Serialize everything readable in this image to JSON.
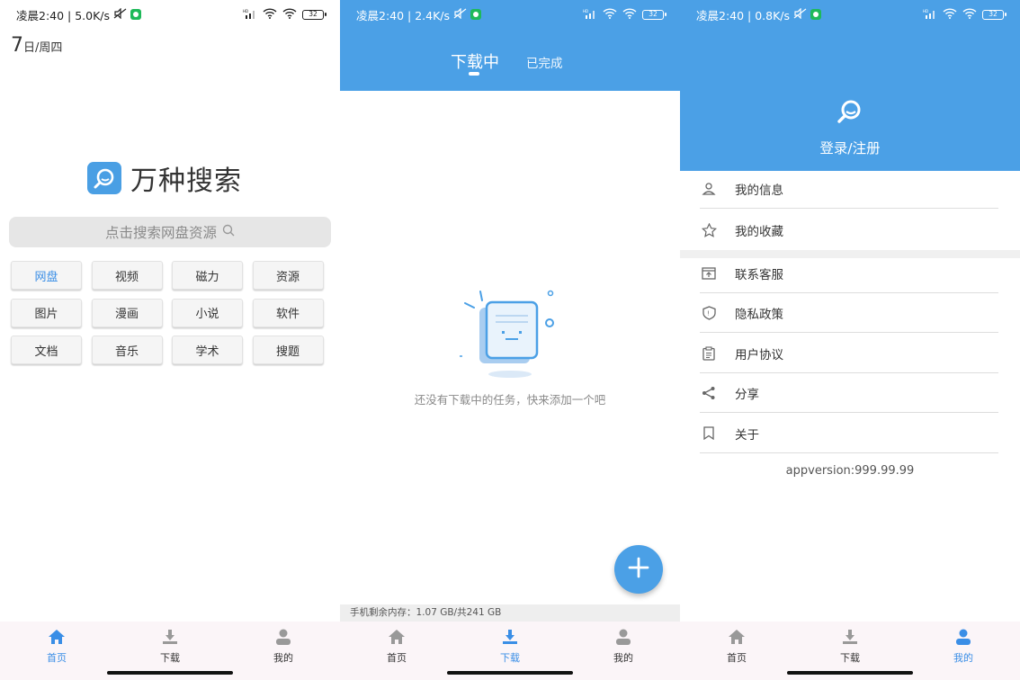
{
  "panels": {
    "home": {
      "status": {
        "time_speed": "凌晨2:40 | 5.0K/s",
        "battery": "32"
      },
      "date": {
        "day": "7",
        "rest": "日/周四"
      },
      "brand": {
        "name": "万种搜索"
      },
      "search": {
        "placeholder": "点击搜索网盘资源"
      },
      "categories": [
        {
          "label": "网盘",
          "active": true
        },
        {
          "label": "视频",
          "active": false
        },
        {
          "label": "磁力",
          "active": false
        },
        {
          "label": "资源",
          "active": false
        },
        {
          "label": "图片",
          "active": false
        },
        {
          "label": "漫画",
          "active": false
        },
        {
          "label": "小说",
          "active": false
        },
        {
          "label": "软件",
          "active": false
        },
        {
          "label": "文档",
          "active": false
        },
        {
          "label": "音乐",
          "active": false
        },
        {
          "label": "学术",
          "active": false
        },
        {
          "label": "搜题",
          "active": false
        }
      ],
      "nav": {
        "home": "首页",
        "download": "下载",
        "mine": "我的",
        "active": "home"
      }
    },
    "download": {
      "status": {
        "time_speed": "凌晨2:40 | 2.4K/s",
        "battery": "32"
      },
      "tabs": {
        "downloading": "下载中",
        "completed": "已完成"
      },
      "empty_text": "还没有下载中的任务，快来添加一个吧",
      "storage": "手机剩余内存：1.07 GB/共241 GB",
      "nav": {
        "home": "首页",
        "download": "下载",
        "mine": "我的",
        "active": "download"
      }
    },
    "mine": {
      "status": {
        "time_speed": "凌晨2:40 | 0.8K/s",
        "battery": "32"
      },
      "login": "登录/注册",
      "menu_group1": [
        {
          "label": "我的信息",
          "icon": "user-icon"
        },
        {
          "label": "我的收藏",
          "icon": "star-icon"
        }
      ],
      "menu_group2": [
        {
          "label": "联系客服",
          "icon": "customer-service-icon"
        },
        {
          "label": "隐私政策",
          "icon": "shield-icon"
        },
        {
          "label": "用户协议",
          "icon": "clipboard-icon"
        },
        {
          "label": "分享",
          "icon": "share-icon"
        },
        {
          "label": "关于",
          "icon": "bookmark-icon"
        }
      ],
      "app_version": "appversion:999.99.99",
      "nav": {
        "home": "首页",
        "download": "下载",
        "mine": "我的",
        "active": "mine"
      }
    }
  },
  "colors": {
    "accent": "#4ba0e6",
    "active_text": "#3a8ee6"
  }
}
